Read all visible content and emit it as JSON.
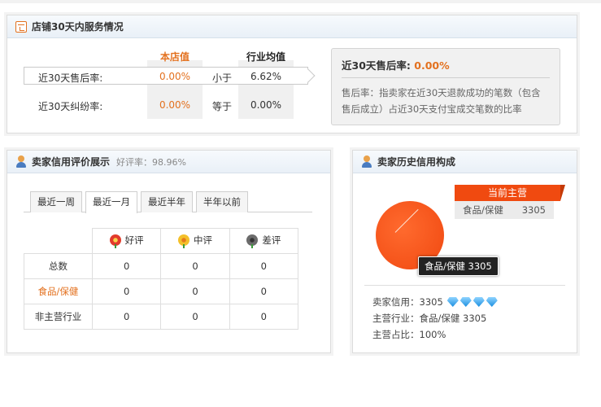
{
  "service_panel": {
    "title": "店铺30天内服务情况",
    "col_shop": "本店值",
    "col_industry": "行业均值",
    "rows": [
      {
        "label": "近30天售后率:",
        "shop": "0.00%",
        "compare": "小于",
        "industry": "6.62%"
      },
      {
        "label": "近30天纠纷率:",
        "shop": "0.00%",
        "compare": "等于",
        "industry": "0.00%"
      }
    ],
    "info": {
      "title_prefix": "近30天售后率:",
      "title_value": "0.00%",
      "text": "售后率：指卖家在近30天退款成功的笔数（包含售后成立）占近30天支付宝成交笔数的比率"
    }
  },
  "rating_panel": {
    "title": "卖家信用评价展示",
    "subtitle": "好评率：98.96%",
    "tabs": [
      "最近一周",
      "最近一月",
      "最近半年",
      "半年以前"
    ],
    "active_tab": 1,
    "headers": [
      "好评",
      "中评",
      "差评"
    ],
    "rows": [
      {
        "label": "总数",
        "values": [
          "0",
          "0",
          "0"
        ]
      },
      {
        "label": "食品/保健",
        "values": [
          "0",
          "0",
          "0"
        ],
        "highlight": true
      },
      {
        "label": "非主营行业",
        "values": [
          "0",
          "0",
          "0"
        ]
      }
    ],
    "colors": {
      "accent": "#e3711f"
    }
  },
  "history_panel": {
    "title": "卖家历史信用构成",
    "main_tag": "当前主营",
    "main_category": "食品/保健",
    "main_value": "3305",
    "pie_tooltip": "食品/保健 3305",
    "credit_label": "卖家信用：",
    "credit_value": "3305",
    "credit_gems": 4,
    "industry_label": "主营行业：",
    "industry_value": "食品/保健 3305",
    "share_label": "主营占比：",
    "share_value": "100%",
    "chart_data": {
      "type": "pie",
      "categories": [
        "食品/保健"
      ],
      "values": [
        3305
      ]
    },
    "colors": {
      "pie": "#f04a10"
    }
  }
}
